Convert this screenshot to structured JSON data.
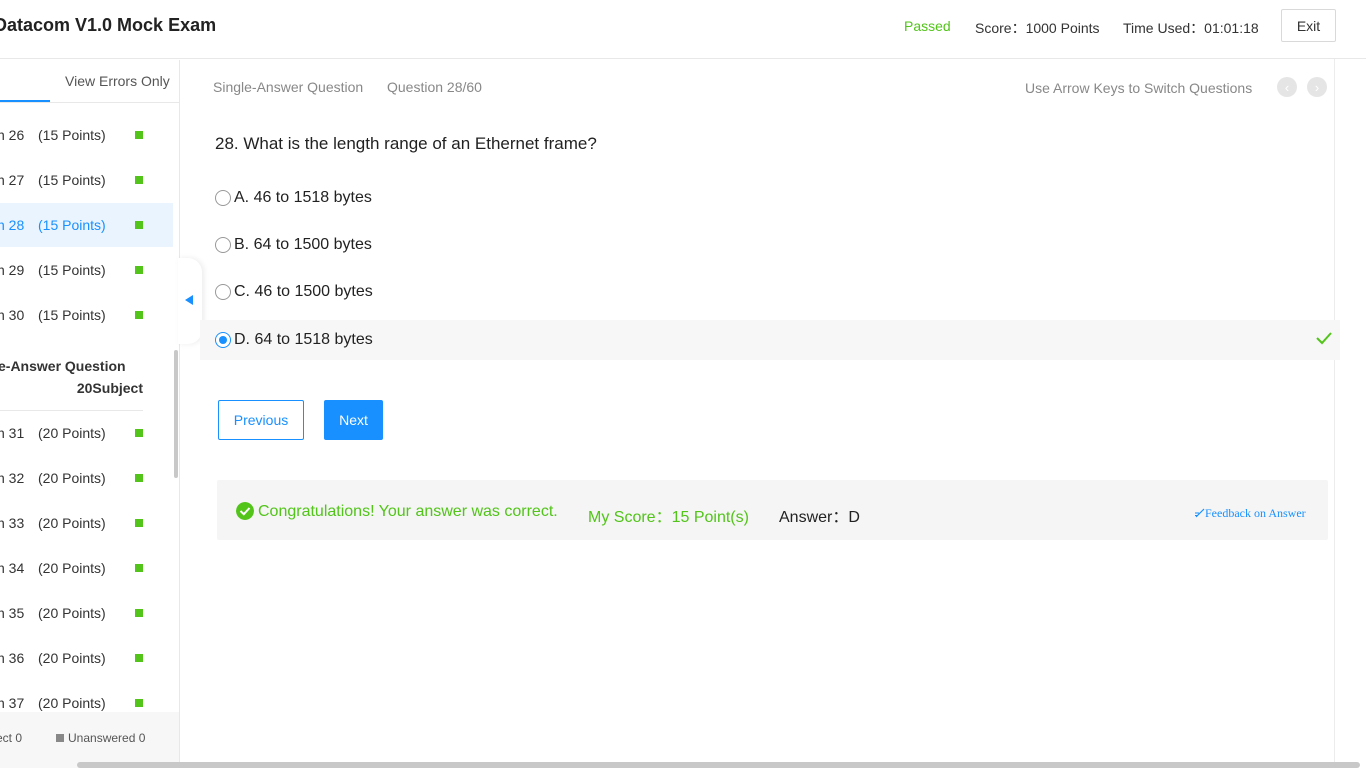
{
  "header": {
    "title": "Datacom V1.0 Mock Exam",
    "status": "Passed",
    "score": "Score：1000 Points",
    "time_used": "Time Used：01:01:18",
    "exit_label": "Exit"
  },
  "sidebar": {
    "view_errors_label": "View Errors Only",
    "items_a": [
      {
        "name": "n 26",
        "points": "(15 Points)"
      },
      {
        "name": "n 27",
        "points": "(15 Points)"
      },
      {
        "name": "n 28",
        "points": "(15 Points)"
      },
      {
        "name": "n 29",
        "points": "(15 Points)"
      },
      {
        "name": "n 30",
        "points": "(15 Points)"
      }
    ],
    "section": {
      "title": "e-Answer Question",
      "count": "20Subject"
    },
    "items_b": [
      {
        "name": "n 31",
        "points": "(20 Points)"
      },
      {
        "name": "n 32",
        "points": "(20 Points)"
      },
      {
        "name": "n 33",
        "points": "(20 Points)"
      },
      {
        "name": "n 34",
        "points": "(20 Points)"
      },
      {
        "name": "n 35",
        "points": "(20 Points)"
      },
      {
        "name": "n 36",
        "points": "(20 Points)"
      },
      {
        "name": "n 37",
        "points": "(20 Points)"
      }
    ],
    "legend": {
      "correct": "ect 0",
      "unanswered": "Unanswered 0"
    }
  },
  "main": {
    "question_type": "Single-Answer Question",
    "question_index": "Question 28/60",
    "hint": "Use Arrow Keys to Switch Questions",
    "question": "28. What is the length range of an Ethernet frame?",
    "options": [
      {
        "text": "A. 46 to 1518 bytes"
      },
      {
        "text": "B. 64 to 1500 bytes"
      },
      {
        "text": "C. 46 to 1500 bytes"
      },
      {
        "text": "D. 64 to 1518 bytes"
      }
    ],
    "selected_option": "D",
    "previous_label": "Previous",
    "next_label": "Next"
  },
  "result": {
    "congrats": "Congratulations! Your answer was correct.",
    "my_score": "My Score：15 Point(s)",
    "answer": "Answer：D",
    "feedback": "Feedback on Answer"
  },
  "colors": {
    "accent": "#1890ff",
    "success": "#52c41a"
  }
}
